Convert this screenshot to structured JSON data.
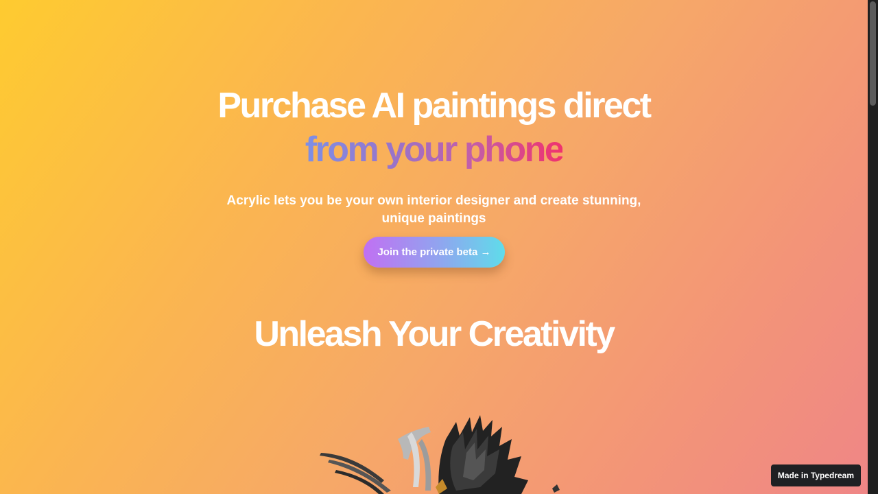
{
  "hero": {
    "title_line1": "Purchase AI paintings direct",
    "title_line2": "from your phone",
    "subtitle": "Acrylic lets you be your own interior designer and create stunning, unique paintings",
    "cta_label": "Join the private beta →"
  },
  "section": {
    "title": "Unleash Your Creativity"
  },
  "artwork": {
    "icon": "abstract-brushstroke-art"
  },
  "badge": {
    "label": "Made in Typedream"
  },
  "colors": {
    "background_start": "#fecb30",
    "background_end": "#ef8686",
    "accent_gradient_start": "#7d8fe6",
    "accent_gradient_end": "#f0326e",
    "button_gradient_start": "#c170f2",
    "button_gradient_end": "#5fdcea",
    "badge_bg": "#1f2023"
  }
}
